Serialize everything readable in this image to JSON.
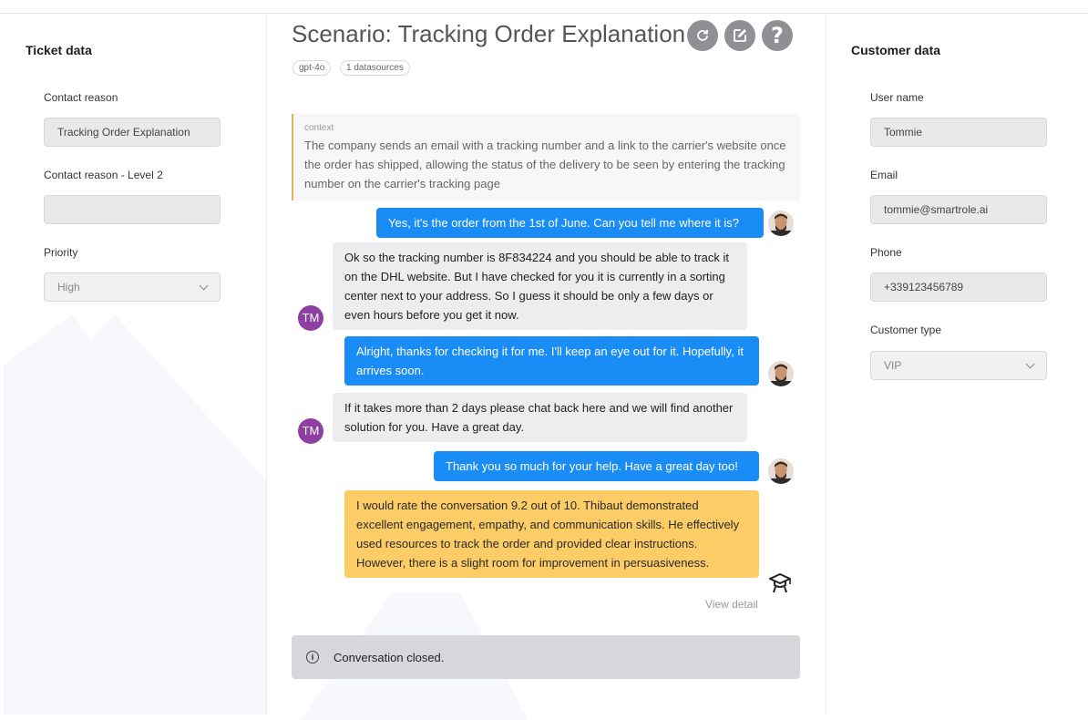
{
  "ticket": {
    "title": "Ticket data",
    "contact_reason_label": "Contact reason",
    "contact_reason_value": "Tracking Order Explanation",
    "contact_reason_l2_label": "Contact reason - Level 2",
    "contact_reason_l2_value": "",
    "priority_label": "Priority",
    "priority_value": "High"
  },
  "scenario": {
    "title": "Scenario: Tracking Order Explanation",
    "tags": [
      "gpt-4o",
      "1 datasources"
    ],
    "icons": [
      "refresh-icon",
      "edit-icon",
      "help-icon"
    ]
  },
  "context": {
    "label": "context",
    "text": "The company sends an email with a tracking number and a link to the carrier's website once the order has shipped, allowing the status of the delivery to be seen by entering the tracking number on the carrier's tracking page"
  },
  "messages": [
    {
      "role": "user",
      "text": "Yes, it's the order from the 1st of June. Can you tell me where it is?"
    },
    {
      "role": "agent",
      "avatar": "TM",
      "text": "Ok so the tracking number is 8F834224 and you should be able to track it on the DHL website. But I have checked for you it is currently in a sorting center next to your address. So I guess it should be only a few days or even hours before you get it now."
    },
    {
      "role": "user",
      "text": "Alright, thanks for checking it for me. I'll keep an eye out for it. Hopefully, it arrives soon."
    },
    {
      "role": "agent",
      "avatar": "TM",
      "text": "If it takes more than 2 days please chat back here and we will find another solution for you. Have a great day."
    },
    {
      "role": "user",
      "text": "Thank you so much for your help. Have a great day too!"
    },
    {
      "role": "feedback",
      "text": "I would rate the conversation 9.2 out of 10. Thibaut demonstrated excellent engagement, empathy, and communication skills. He effectively used resources to track the order and provided clear instructions. However, there is a slight room for improvement in persuasiveness."
    }
  ],
  "view_detail": "View detail",
  "status": {
    "text": "Conversation closed.",
    "icon": "info-icon"
  },
  "customer": {
    "title": "Customer data",
    "username_label": "User name",
    "username_value": "Tommie",
    "email_label": "Email",
    "email_value": "tommie@smartrole.ai",
    "phone_label": "Phone",
    "phone_value": "+339123456789",
    "type_label": "Customer type",
    "type_value": "VIP"
  },
  "colors": {
    "user_bubble": "#1a8cf5",
    "agent_bubble": "#ededf0",
    "feedback_bubble": "#fccc66",
    "agent_avatar": "#8f3fa2",
    "context_accent": "#e0b255"
  }
}
